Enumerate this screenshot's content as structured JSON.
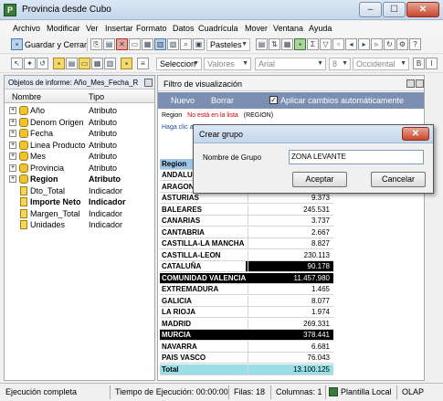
{
  "window": {
    "title": "Provincia desde Cubo",
    "minimize": "–",
    "maximize": "☐",
    "close": "✕"
  },
  "menu": [
    "Archivo",
    "Modificar",
    "Ver",
    "Insertar",
    "Formato",
    "Datos",
    "Cuadrícula",
    "Mover",
    "Ventana",
    "Ayuda"
  ],
  "toolbar1": {
    "save_close": "Guardar y Cerrar",
    "view_combo": "Pasteles"
  },
  "toolbar2": {
    "select_combo": "Seleccion",
    "values_combo": "Valores",
    "font_combo": "Arial",
    "size_combo": "8",
    "region_combo": "Occidental"
  },
  "left": {
    "header": "Objetos de informe: Año_Mes_Fecha_R",
    "col_name": "Nombre",
    "col_type": "Tipo",
    "rows": [
      {
        "name": "Año",
        "type": "Atributo"
      },
      {
        "name": "Denom Origen",
        "type": "Atributo"
      },
      {
        "name": "Fecha",
        "type": "Atributo"
      },
      {
        "name": "Linea Producto",
        "type": "Atributo"
      },
      {
        "name": "Mes",
        "type": "Atributo"
      },
      {
        "name": "Provincia",
        "type": "Atributo"
      },
      {
        "name": "Region",
        "type": "Atributo"
      },
      {
        "name": "Dto_Total",
        "type": "Indicador"
      },
      {
        "name": "Importe Neto",
        "type": "Indicador"
      },
      {
        "name": "Margen_Total",
        "type": "Indicador"
      },
      {
        "name": "Unidades",
        "type": "Indicador"
      }
    ]
  },
  "right": {
    "header": "Filtro de visualización",
    "new": "Nuevo",
    "delete": "Borrar",
    "auto_apply": "Aplicar cambios automáticamente",
    "region_label": "Region",
    "region_not_in": "No está en la lista",
    "region_value": "(REGION)",
    "hint": "Haga clic a",
    "grid_header": "Region",
    "rows": [
      {
        "region": "ANDALUCIA",
        "value": "",
        "style": "normal"
      },
      {
        "region": "ARAGON",
        "value": "",
        "style": "normal"
      },
      {
        "region": "ASTURIAS",
        "value": "9.373",
        "style": "normal"
      },
      {
        "region": "BALEARES",
        "value": "245.531",
        "style": "normal"
      },
      {
        "region": "CANARIAS",
        "value": "3.737",
        "style": "normal"
      },
      {
        "region": "CANTABRIA",
        "value": "2.667",
        "style": "normal"
      },
      {
        "region": "CASTILLA-LA MANCHA",
        "value": "8.827",
        "style": "normal"
      },
      {
        "region": "CASTILLA-LEON",
        "value": "230.113",
        "style": "normal"
      },
      {
        "region": "CATALUÑA",
        "value": "90.178",
        "style": "partsel"
      },
      {
        "region": "COMUNIDAD VALENCIA",
        "value": "11.457.980",
        "style": "sel"
      },
      {
        "region": "EXTREMADURA",
        "value": "1.465",
        "style": "normal"
      },
      {
        "region": "GALICIA",
        "value": "8.077",
        "style": "normal"
      },
      {
        "region": "LA RIOJA",
        "value": "1.974",
        "style": "normal"
      },
      {
        "region": "MADRID",
        "value": "269.331",
        "style": "normal"
      },
      {
        "region": "MURCIA",
        "value": "378.441",
        "style": "sel"
      },
      {
        "region": "NAVARRA",
        "value": "6.681",
        "style": "normal"
      },
      {
        "region": "PAIS VASCO",
        "value": "76.043",
        "style": "normal"
      },
      {
        "region": "Total",
        "value": "13.100.125",
        "style": "total"
      }
    ]
  },
  "dialog": {
    "title": "Crear grupo",
    "label": "Nombre de Grupo",
    "value": "ZONA LEVANTE",
    "accept": "Aceptar",
    "cancel": "Cancelar"
  },
  "status": {
    "state": "Ejecución completa",
    "time": "Tiempo de Ejecución: 00:00:00",
    "rows": "Filas: 18",
    "cols": "Columnas: 1",
    "template": "Plantilla Local",
    "mode": "OLAP"
  }
}
